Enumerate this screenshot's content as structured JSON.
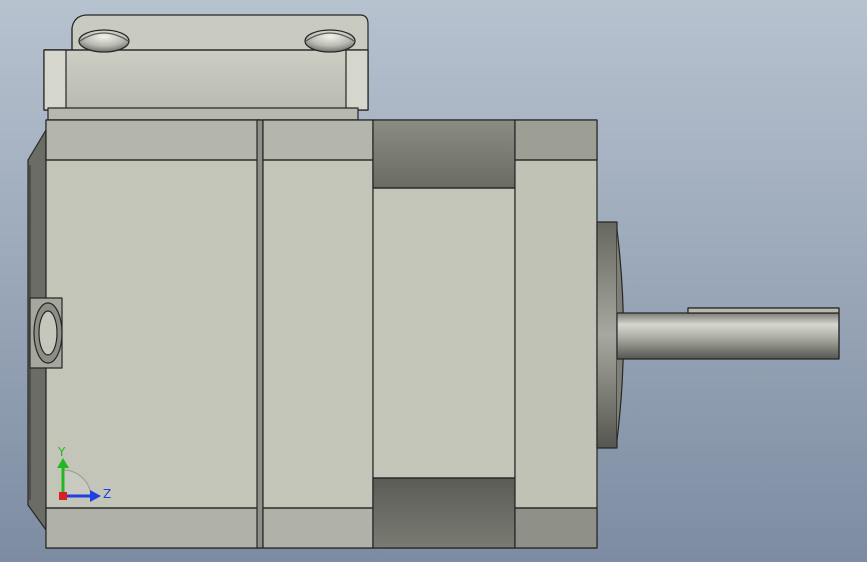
{
  "viewport": {
    "background_top": "#b4bfcc",
    "background_bottom": "#7f8ea3",
    "body_color": "#c3c4b8",
    "body_dark": "#6d6f66",
    "edge_color": "#2b2b2b",
    "shaft_color": "#9c9d95"
  },
  "triad": {
    "y_label": "Y",
    "z_label": "Z",
    "y_color": "#21b821",
    "z_color": "#1f3fe0",
    "x_color": "#d91f1f"
  }
}
